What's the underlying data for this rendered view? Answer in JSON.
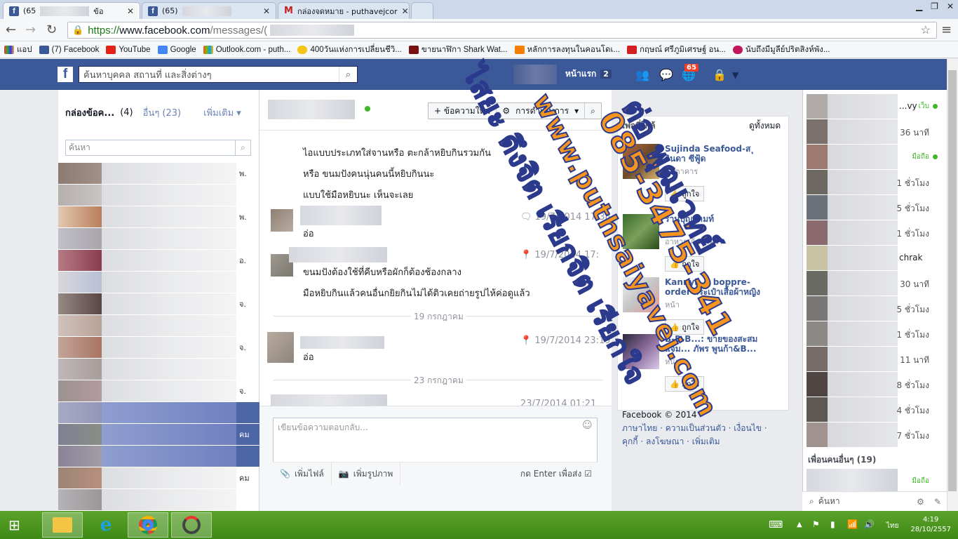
{
  "browser": {
    "tabs": [
      {
        "title": "(65",
        "title_tail": "ข้อ"
      },
      {
        "title": "(65)"
      },
      {
        "title": "กล่องจดหมาย - puthavejcor"
      }
    ],
    "address": {
      "scheme": "https://",
      "host": "www.facebook.com",
      "path": "/messages/("
    },
    "bookmarks": [
      {
        "label": "แอป",
        "icon": "apps-icon"
      },
      {
        "label": "(7) Facebook",
        "icon": "facebook-icon"
      },
      {
        "label": "YouTube",
        "icon": "youtube-icon"
      },
      {
        "label": "Google",
        "icon": "google-icon"
      },
      {
        "label": "Outlook.com - puth...",
        "icon": "outlook-icon"
      },
      {
        "label": "400วันแห่งการเปลี่ยนชีวิ...",
        "icon": "smiley-icon"
      },
      {
        "label": "ขายนาฬิกา Shark Wat...",
        "icon": "watch-icon"
      },
      {
        "label": "หลักการลงทุนในคอนโดเ...",
        "icon": "blogger-icon"
      },
      {
        "label": "กฤษณ์ ศรีภูมิเศรษฐ์ อน...",
        "icon": "sj-icon"
      },
      {
        "label": "นับถึงมีมูลีย์ปริตสิงห์พัง...",
        "icon": "orb-icon"
      }
    ]
  },
  "fb": {
    "search_placeholder": "ค้นหาบุคคล สถานที่ และสิ่งต่างๆ",
    "home_label": "หน้าแรก",
    "home_count": "2",
    "notif_count": "65"
  },
  "inbox": {
    "title": "กล่องข้อค...",
    "title_count": "(4)",
    "other_label": "อื่นๆ (23)",
    "more_label": "เพิ่มเติม",
    "search_placeholder": "ค้นหา",
    "conv_labels": [
      "พ.",
      "พ.",
      "อ.",
      "จ.",
      "จ.",
      "จ.",
      "คม",
      "คม"
    ]
  },
  "chat": {
    "new_message": "+ ข้อความใหม่",
    "actions": "การดำเนินการ",
    "messages": [
      {
        "text": "ไอแบบประเภทใส่จานหรือ ตะกล้าหยิบกินรวมกัน"
      },
      {
        "text": "หรือ ขนมปังคนนุ่นคนนี้หยิบกินนะ"
      },
      {
        "text": "แบบใช้มือหยิบนะ เห็นจะเลย"
      },
      {
        "text": "อ่อ",
        "time": "19/7/2014 17:38"
      },
      {
        "text": "ขนมปังต้องใช้ที่คีบหรือผักก็ต้องช้องกลาง",
        "time": "19/7/2014 17:"
      },
      {
        "text": "มือหยิบกินแล้วคนอื่นกยิยกินไม่ได้ติวเคยถ่ายรูปไห้ค่อดูแล้ว"
      },
      {
        "text": "อ่อ",
        "time": "19/7/2014 23:19"
      }
    ],
    "separators": [
      "19 กรกฎาคม",
      "23 กรกฎาคม"
    ],
    "last_time": "23/7/2014 01:21",
    "reply_placeholder": "เขียนข้อความตอบกลับ...",
    "attach_file": "เพิ่มไฟล์",
    "attach_photo": "เพิ่มรูปภาพ",
    "enter_to_send": "กด Enter เพื่อส่ง"
  },
  "suggested": {
    "title": "เพจที่ใกล้",
    "see_all": "ดูทั้งหมด",
    "pages": [
      {
        "name": "Sujinda Seafood-ส ุจินดา ซีฟู้ด",
        "category": "ภัตตาคาร",
        "like": "ถูกใจ"
      },
      {
        "name": "ร้านบุญนามท์",
        "category": "อาหาร/ภัตตาคาร",
        "like": "ถูกใจ"
      },
      {
        "name": "Kannyb... boppre-order กระเป๋าเสื้อผ้าหญิง",
        "category": "หน้า",
        "like": "ถูกใจ"
      },
      {
        "name": "B-B-B...: ขายของสะสม แจม... ภัพร พูนก้า&B...",
        "category": "หน้า",
        "like": "ถูกใจ"
      }
    ],
    "footer": "Facebook © 2014",
    "footer_links": "ภาษาไทย · ความเป็นส่วนตัว · เงื่อนไข · คุกกี้ · ลงโฆษณา · เพิ่มเติม"
  },
  "friends": {
    "items": [
      {
        "status": "เว็บ",
        "online": true,
        "name": "...vy"
      },
      {
        "status": "36 นาที"
      },
      {
        "status": "มือถือ",
        "online": true
      },
      {
        "status": "1 ชั่วโมง"
      },
      {
        "status": "5 ชั่วโมง"
      },
      {
        "status": "1 ชั่วโมง"
      },
      {
        "status": "",
        "name": "chrak"
      },
      {
        "status": "30 นาที"
      },
      {
        "status": "5 ชั่วโมง"
      },
      {
        "status": "1 ชั่วโมง"
      },
      {
        "status": "11 นาที"
      },
      {
        "status": "8 ชั่วโมง"
      },
      {
        "status": "4 ชั่วโมง"
      },
      {
        "status": "7 ชั่วโมง"
      }
    ],
    "more_friends": "เพื่อนคนอื่นๆ (19)",
    "more_status": "มือถือ",
    "search": "ค้นหา"
  },
  "watermark": {
    "line1": "ต่อ พุฒเวทย์",
    "line2": "085-3475-341",
    "line3": "www.puthsaiyavej.com",
    "line4": "ไสยะ ดึงจิต เรียกจิต เรียกใจ"
  },
  "taskbar": {
    "lang": "ไทย",
    "time": "4:19",
    "date": "28/10/2557"
  },
  "colors": {
    "fb_blue": "#3b5998",
    "watermark_fill": "#f7941d",
    "watermark_stroke": "#2b3a8c",
    "taskbar": "#4c9a20"
  }
}
